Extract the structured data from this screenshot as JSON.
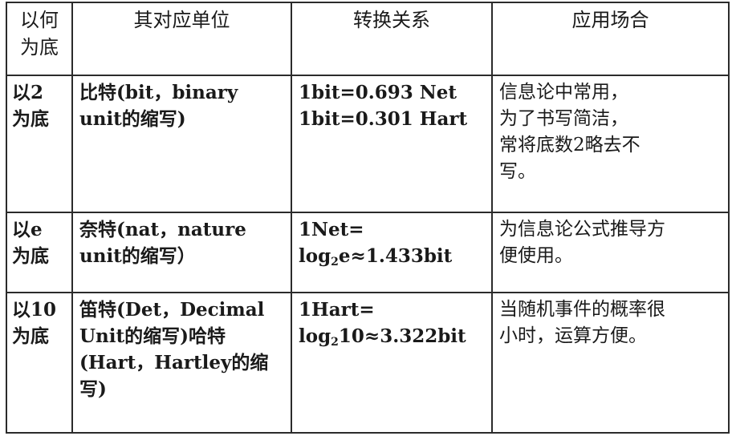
{
  "headers": {
    "base": [
      "以何",
      "为底"
    ],
    "unit": "其对应单位",
    "conversion": "转换关系",
    "application": "应用场合"
  },
  "rows": [
    {
      "base": [
        "以2",
        "为底"
      ],
      "unit": [
        "比特(bit，binary",
        "unit的缩写)"
      ],
      "conversion": {
        "line1": "1bit=0.693 Net",
        "line2": "1bit=0.301 Hart"
      },
      "application": [
        "信息论中常用，",
        "为了书写简洁，",
        "常将底数2略去不",
        "写。"
      ]
    },
    {
      "base": [
        "以e",
        "为底"
      ],
      "unit": [
        "奈特(nat，nature",
        "unit的缩写）"
      ],
      "conversion": {
        "line1": "1Net=",
        "log": "log",
        "sub": "2",
        "rest": "e≈1.433bit"
      },
      "application": [
        "为信息论公式推导方",
        "便使用。"
      ]
    },
    {
      "base": [
        "以10",
        "为底"
      ],
      "unit": [
        "笛特(Det，Decimal",
        "Unit的缩写)哈特",
        "(Hart，Hartley的缩",
        "写)"
      ],
      "conversion": {
        "line1": "1Hart=",
        "log": "log",
        "sub": "2",
        "rest": "10≈3.322bit"
      },
      "application": [
        "当随机事件的概率很",
        "小时，运算方便。"
      ]
    }
  ]
}
